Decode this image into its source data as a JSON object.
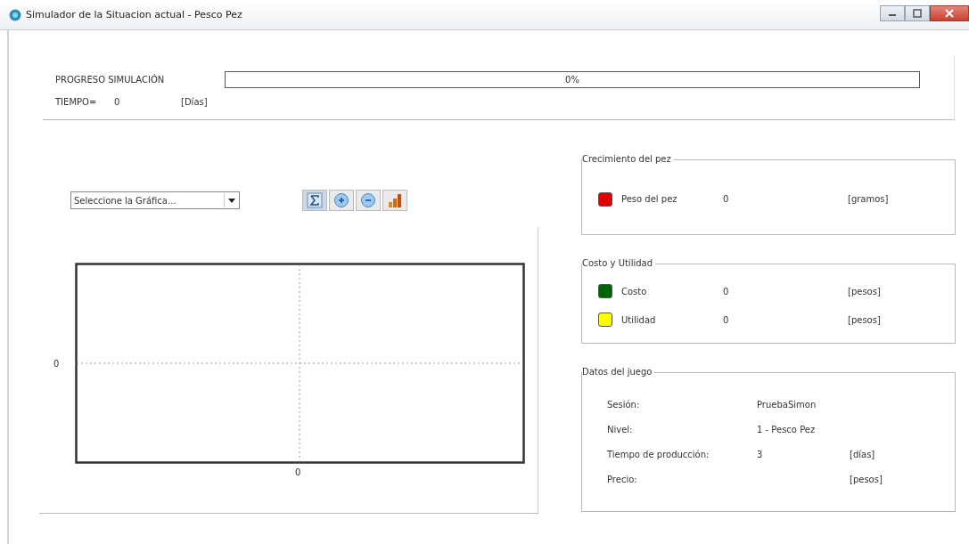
{
  "window": {
    "title": "Simulador de la Situacion actual - Pesco Pez"
  },
  "progress": {
    "label": "PROGRESO SIMULACIÓN",
    "level": 0,
    "reading": "0%"
  },
  "time": {
    "label": "TIEMPO=",
    "value": "0",
    "unit": "[Días]"
  },
  "chart_selector": {
    "value": "Seleccione la Gráfica..."
  },
  "toolbar": [
    {
      "kind": "sigma"
    },
    {
      "kind": "zoom-in"
    },
    {
      "kind": "zoom-out"
    },
    {
      "kind": "chart"
    }
  ],
  "plot": {
    "y_tick": "0",
    "x_tick": "0"
  },
  "groups": [
    {
      "title": "Crecimiento del pez",
      "rows": [
        {
          "color": "#e00000",
          "label": "Peso del pez",
          "value": "0",
          "unit": "[gramos]"
        }
      ]
    },
    {
      "title": "Costo y Utilidad",
      "rows": [
        {
          "color": "#006400",
          "label": "Costo",
          "value": "0",
          "unit": "[pesos]"
        },
        {
          "color": "#ffff00",
          "label": "Utilidad",
          "value": "0",
          "unit": "[pesos]"
        }
      ]
    },
    {
      "title": "Datos del juego",
      "rows": [
        {
          "label": "Sesión:",
          "value": "PruebaSimon"
        },
        {
          "label": "Nivel:",
          "value": "1 - Pesco Pez"
        },
        {
          "label": "Tiempo de producción:",
          "value": "3",
          "unit": "[días]"
        },
        {
          "label": "Precio:",
          "unit": "[pesos]"
        }
      ]
    }
  ]
}
